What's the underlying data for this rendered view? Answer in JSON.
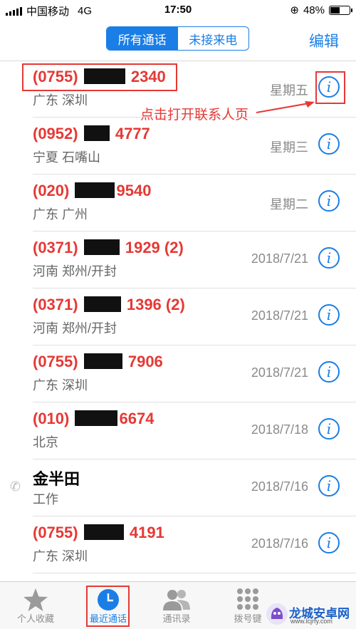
{
  "status_bar": {
    "carrier": "中国移动",
    "network": "4G",
    "time": "17:50",
    "battery": "48%",
    "battery_level": 0.48
  },
  "header": {
    "segments": [
      "所有通话",
      "未接来电"
    ],
    "selected_segment": 0,
    "edit": "编辑"
  },
  "calls": [
    {
      "number_prefix": "(0755)",
      "number_suffix": "2340",
      "location": "广东 深圳",
      "date": "星期五",
      "missed": true
    },
    {
      "number_prefix": "(0952)",
      "number_suffix": "4777",
      "location": "宁夏 石嘴山",
      "date": "星期三",
      "missed": true
    },
    {
      "number_prefix": "(020)",
      "number_suffix": "9540",
      "location": "广东 广州",
      "date": "星期二",
      "missed": true
    },
    {
      "number_prefix": "(0371)",
      "number_suffix": "1929 (2)",
      "location": "河南 郑州/开封",
      "date": "2018/7/21",
      "missed": true
    },
    {
      "number_prefix": "(0371)",
      "number_suffix": "1396 (2)",
      "location": "河南 郑州/开封",
      "date": "2018/7/21",
      "missed": true
    },
    {
      "number_prefix": "(0755)",
      "number_suffix": "7906",
      "location": "广东 深圳",
      "date": "2018/7/21",
      "missed": true
    },
    {
      "number_prefix": "(010)",
      "number_suffix": "6674",
      "location": "北京",
      "date": "2018/7/18",
      "missed": true
    },
    {
      "name": "金半田",
      "location": "工作",
      "date": "2018/7/16",
      "missed": false
    },
    {
      "number_prefix": "(0755)",
      "number_suffix": "4191",
      "location": "广东 深圳",
      "date": "2018/7/16",
      "missed": true
    }
  ],
  "annotation": {
    "text": "点击打开联系人页"
  },
  "tab_bar": [
    {
      "label": "个人收藏",
      "icon": "star-icon"
    },
    {
      "label": "最近通话",
      "icon": "clock-icon",
      "active": true
    },
    {
      "label": "通讯录",
      "icon": "contacts-icon"
    },
    {
      "label": "拨号键",
      "icon": "keypad-icon"
    }
  ],
  "watermark": {
    "name": "龙城安卓网",
    "url": "www.lcjrfy.com"
  },
  "colors": {
    "accent": "#1a7ee6",
    "missed": "#e53935",
    "annotation": "#e53935"
  }
}
